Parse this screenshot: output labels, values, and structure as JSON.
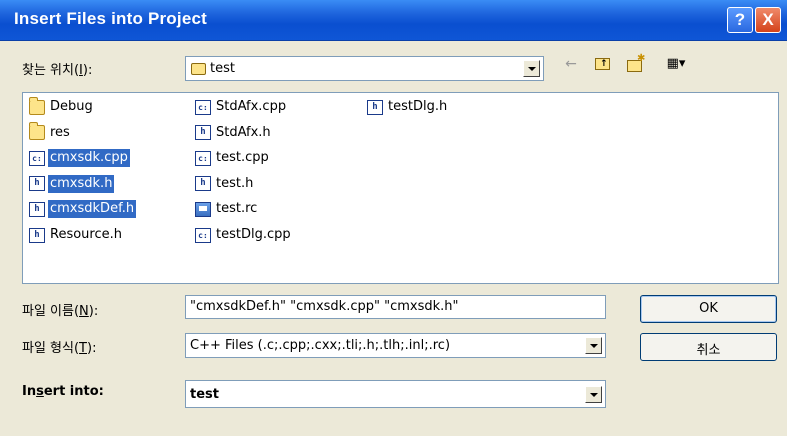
{
  "window": {
    "title": "Insert Files into Project",
    "help_label": "?",
    "close_label": "X"
  },
  "look_in": {
    "label_before": "찾는 위치(",
    "label_key": "I",
    "label_after": "):",
    "value": "test"
  },
  "toolbar": {
    "back_icon": "←",
    "view_menu_icon": "▦▾"
  },
  "files": [
    {
      "name": "Debug",
      "icon": "folder-icon",
      "selected": false
    },
    {
      "name": "res",
      "icon": "folder-icon",
      "selected": false
    },
    {
      "name": "cmxsdk.cpp",
      "icon": "cpp-file-icon",
      "selected": true
    },
    {
      "name": "cmxsdk.h",
      "icon": "h-file-icon",
      "selected": true
    },
    {
      "name": "cmxsdkDef.h",
      "icon": "h-file-icon",
      "selected": true
    },
    {
      "name": "Resource.h",
      "icon": "h-file-icon",
      "selected": false
    },
    {
      "name": "StdAfx.cpp",
      "icon": "cpp-file-icon",
      "selected": false
    },
    {
      "name": "StdAfx.h",
      "icon": "h-file-icon",
      "selected": false
    },
    {
      "name": "test.cpp",
      "icon": "cpp-file-icon",
      "selected": false
    },
    {
      "name": "test.h",
      "icon": "h-file-icon",
      "selected": false
    },
    {
      "name": "test.rc",
      "icon": "rc-file-icon",
      "selected": false
    },
    {
      "name": "testDlg.cpp",
      "icon": "cpp-file-icon",
      "selected": false
    },
    {
      "name": "testDlg.h",
      "icon": "h-file-icon",
      "selected": false
    }
  ],
  "icon_glyphs": {
    "h": "h",
    "cpp": "c:"
  },
  "file_name": {
    "label_before": "파일 이름(",
    "label_key": "N",
    "label_after": "):",
    "value": "\"cmxsdkDef.h\" \"cmxsdk.cpp\" \"cmxsdk.h\""
  },
  "file_type": {
    "label_before": "파일 형식(",
    "label_key": "T",
    "label_after": "):",
    "value": "C++ Files (.c;.cpp;.cxx;.tli;.h;.tlh;.inl;.rc)"
  },
  "insert_into": {
    "label_before": "In",
    "label_key": "s",
    "label_after": "ert into:",
    "value": "test"
  },
  "buttons": {
    "ok": "OK",
    "cancel": "취소"
  }
}
